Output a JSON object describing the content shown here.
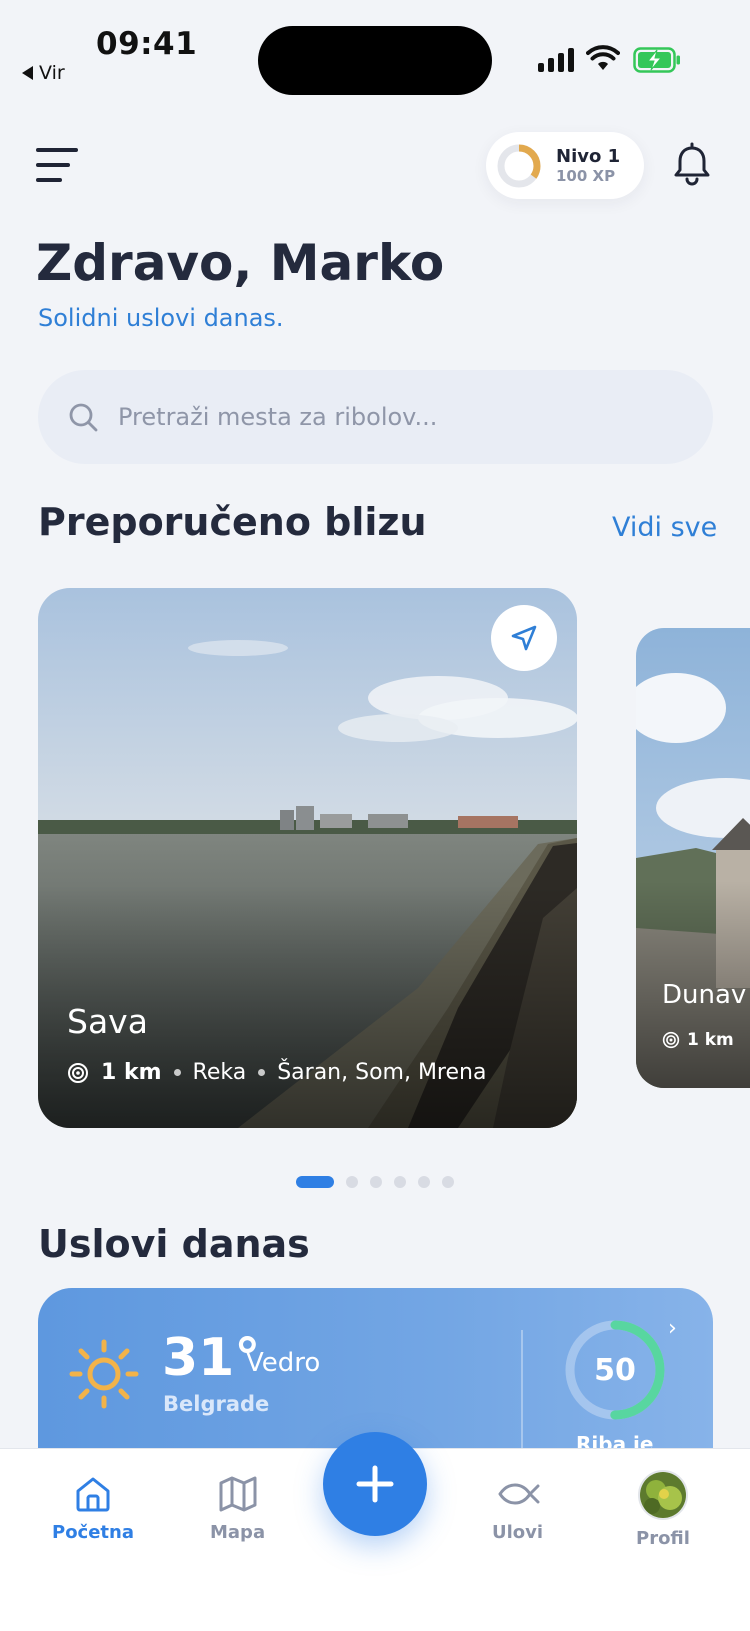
{
  "status_bar": {
    "time": "09:41",
    "back_label": "Vir"
  },
  "header": {
    "level_title": "Nivo 1",
    "level_xp": "100 XP",
    "level_progress": 0.35
  },
  "greeting": {
    "title": "Zdravo, Marko",
    "subtitle": "Solidni uslovi danas."
  },
  "search": {
    "placeholder": "Pretraži mesta za ribolov..."
  },
  "recommended": {
    "title": "Preporučeno blizu",
    "see_all": "Vidi sve",
    "cards": [
      {
        "name": "Sava",
        "distance": "1 km",
        "type": "Reka",
        "fish": "Šaran, Som, Mrena"
      },
      {
        "name": "Dunav",
        "distance": "1 km"
      }
    ],
    "pager_count": 6,
    "pager_active": 0
  },
  "conditions": {
    "title": "Uslovi danas",
    "temperature": "31°",
    "condition": "Vedro",
    "city": "Belgrade",
    "score": "50",
    "score_value": 50,
    "score_label": "Riba je"
  },
  "tabbar": {
    "home": "Početna",
    "map": "Mapa",
    "catches": "Ulovi",
    "profile": "Profil"
  },
  "colors": {
    "accent": "#2f7fe4",
    "level_ring": "#e2a94e",
    "battery": "#34c759",
    "score_ring": "#58d6a0"
  }
}
